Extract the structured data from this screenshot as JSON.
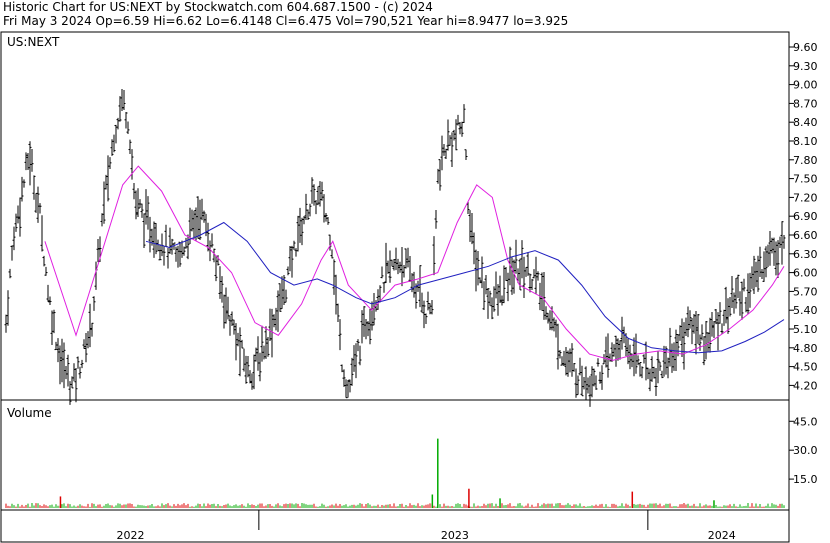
{
  "header": {
    "line1": "Historic Chart for US:NEXT by Stockwatch.com 604.687.1500 - (c) 2024",
    "line2": "Fri May  3 2024   Op=6.59   Hi=6.62   Lo=6.4148   Cl=6.475   Vol=790,521   Year hi=8.9477   lo=3.925"
  },
  "colors": {
    "price_bars": "#000000",
    "ma_short": "#e020e0",
    "ma_long": "#2020c0",
    "vol_up": "#00aa00",
    "vol_down": "#dd0000",
    "frame": "#000000"
  },
  "chart_data": [
    {
      "type": "candlestick",
      "title": "US:NEXT",
      "ylim": [
        3.925,
        9.8
      ],
      "y_ticks": [
        "9.60",
        "9.30",
        "9.00",
        "8.70",
        "8.40",
        "8.10",
        "7.80",
        "7.50",
        "7.20",
        "6.90",
        "6.60",
        "6.30",
        "6.00",
        "5.70",
        "5.40",
        "5.10",
        "4.80",
        "4.50",
        "4.20"
      ],
      "x_ticks": [
        "2022",
        "2023",
        "2024"
      ],
      "x_range": [
        0,
        1
      ],
      "price_path": [
        [
          0.0,
          5.2
        ],
        [
          0.01,
          6.6
        ],
        [
          0.03,
          7.9
        ],
        [
          0.045,
          6.8
        ],
        [
          0.055,
          5.6
        ],
        [
          0.07,
          4.6
        ],
        [
          0.085,
          4.2
        ],
        [
          0.1,
          4.7
        ],
        [
          0.11,
          5.2
        ],
        [
          0.125,
          7.0
        ],
        [
          0.14,
          8.3
        ],
        [
          0.15,
          8.8
        ],
        [
          0.158,
          8.4
        ],
        [
          0.165,
          7.2
        ],
        [
          0.18,
          6.8
        ],
        [
          0.2,
          6.5
        ],
        [
          0.22,
          6.2
        ],
        [
          0.235,
          6.6
        ],
        [
          0.25,
          7.0
        ],
        [
          0.265,
          6.4
        ],
        [
          0.28,
          5.6
        ],
        [
          0.3,
          4.8
        ],
        [
          0.312,
          4.4
        ],
        [
          0.325,
          4.6
        ],
        [
          0.34,
          5.1
        ],
        [
          0.36,
          5.8
        ],
        [
          0.375,
          6.6
        ],
        [
          0.39,
          7.1
        ],
        [
          0.405,
          7.2
        ],
        [
          0.418,
          6.6
        ],
        [
          0.425,
          5.5
        ],
        [
          0.432,
          4.6
        ],
        [
          0.44,
          4.1
        ],
        [
          0.45,
          4.6
        ],
        [
          0.46,
          5.1
        ],
        [
          0.475,
          5.6
        ],
        [
          0.49,
          6.0
        ],
        [
          0.51,
          6.2
        ],
        [
          0.525,
          5.8
        ],
        [
          0.54,
          5.4
        ],
        [
          0.548,
          5.5
        ],
        [
          0.555,
          7.5
        ],
        [
          0.565,
          8.0
        ],
        [
          0.578,
          8.2
        ],
        [
          0.59,
          8.4
        ],
        [
          0.595,
          6.8
        ],
        [
          0.605,
          6.1
        ],
        [
          0.62,
          5.6
        ],
        [
          0.635,
          5.6
        ],
        [
          0.65,
          6.0
        ],
        [
          0.665,
          6.1
        ],
        [
          0.68,
          5.9
        ],
        [
          0.7,
          5.3
        ],
        [
          0.715,
          4.7
        ],
        [
          0.73,
          4.4
        ],
        [
          0.75,
          4.3
        ],
        [
          0.77,
          4.5
        ],
        [
          0.79,
          4.9
        ],
        [
          0.805,
          4.7
        ],
        [
          0.82,
          4.5
        ],
        [
          0.835,
          4.4
        ],
        [
          0.85,
          4.6
        ],
        [
          0.865,
          4.9
        ],
        [
          0.88,
          5.2
        ],
        [
          0.9,
          4.9
        ],
        [
          0.915,
          5.2
        ],
        [
          0.935,
          5.6
        ],
        [
          0.955,
          5.7
        ],
        [
          0.97,
          6.1
        ],
        [
          0.985,
          6.4
        ],
        [
          1.0,
          6.475
        ]
      ],
      "moving_average_short": [
        [
          0.05,
          6.5
        ],
        [
          0.09,
          5.0
        ],
        [
          0.12,
          6.2
        ],
        [
          0.15,
          7.4
        ],
        [
          0.17,
          7.7
        ],
        [
          0.2,
          7.3
        ],
        [
          0.23,
          6.6
        ],
        [
          0.26,
          6.4
        ],
        [
          0.29,
          6.0
        ],
        [
          0.32,
          5.2
        ],
        [
          0.35,
          5.0
        ],
        [
          0.38,
          5.5
        ],
        [
          0.405,
          6.2
        ],
        [
          0.42,
          6.5
        ],
        [
          0.44,
          5.8
        ],
        [
          0.47,
          5.4
        ],
        [
          0.5,
          5.8
        ],
        [
          0.53,
          5.9
        ],
        [
          0.555,
          6.0
        ],
        [
          0.58,
          6.8
        ],
        [
          0.605,
          7.4
        ],
        [
          0.625,
          7.2
        ],
        [
          0.645,
          6.2
        ],
        [
          0.66,
          5.8
        ],
        [
          0.69,
          5.6
        ],
        [
          0.72,
          5.1
        ],
        [
          0.75,
          4.7
        ],
        [
          0.78,
          4.6
        ],
        [
          0.81,
          4.7
        ],
        [
          0.84,
          4.75
        ],
        [
          0.87,
          4.7
        ],
        [
          0.9,
          4.85
        ],
        [
          0.93,
          5.1
        ],
        [
          0.96,
          5.4
        ],
        [
          0.985,
          5.8
        ],
        [
          1.0,
          6.1
        ]
      ],
      "moving_average_long": [
        [
          0.18,
          6.5
        ],
        [
          0.21,
          6.4
        ],
        [
          0.25,
          6.6
        ],
        [
          0.28,
          6.8
        ],
        [
          0.31,
          6.5
        ],
        [
          0.34,
          6.0
        ],
        [
          0.37,
          5.8
        ],
        [
          0.4,
          5.9
        ],
        [
          0.42,
          5.8
        ],
        [
          0.45,
          5.6
        ],
        [
          0.47,
          5.5
        ],
        [
          0.5,
          5.6
        ],
        [
          0.53,
          5.8
        ],
        [
          0.56,
          5.9
        ],
        [
          0.59,
          6.0
        ],
        [
          0.62,
          6.1
        ],
        [
          0.65,
          6.25
        ],
        [
          0.68,
          6.35
        ],
        [
          0.71,
          6.2
        ],
        [
          0.74,
          5.8
        ],
        [
          0.77,
          5.3
        ],
        [
          0.8,
          4.95
        ],
        [
          0.83,
          4.8
        ],
        [
          0.86,
          4.75
        ],
        [
          0.89,
          4.72
        ],
        [
          0.92,
          4.75
        ],
        [
          0.95,
          4.9
        ],
        [
          0.975,
          5.05
        ],
        [
          1.0,
          5.25
        ]
      ]
    },
    {
      "type": "bar",
      "title": "Volume",
      "ylim": [
        0,
        55
      ],
      "y_ticks": [
        "45.0",
        "30.0",
        "15.0"
      ],
      "baseline": 2.0,
      "spikes": [
        {
          "x": 0.07,
          "value": 6.0,
          "direction": "down"
        },
        {
          "x": 0.555,
          "value": 36.0,
          "direction": "up"
        },
        {
          "x": 0.548,
          "value": 7.0,
          "direction": "up"
        },
        {
          "x": 0.595,
          "value": 10.0,
          "direction": "down"
        },
        {
          "x": 0.635,
          "value": 5.0,
          "direction": "up"
        },
        {
          "x": 0.805,
          "value": 8.5,
          "direction": "down"
        },
        {
          "x": 0.91,
          "value": 4.0,
          "direction": "up"
        }
      ]
    }
  ]
}
